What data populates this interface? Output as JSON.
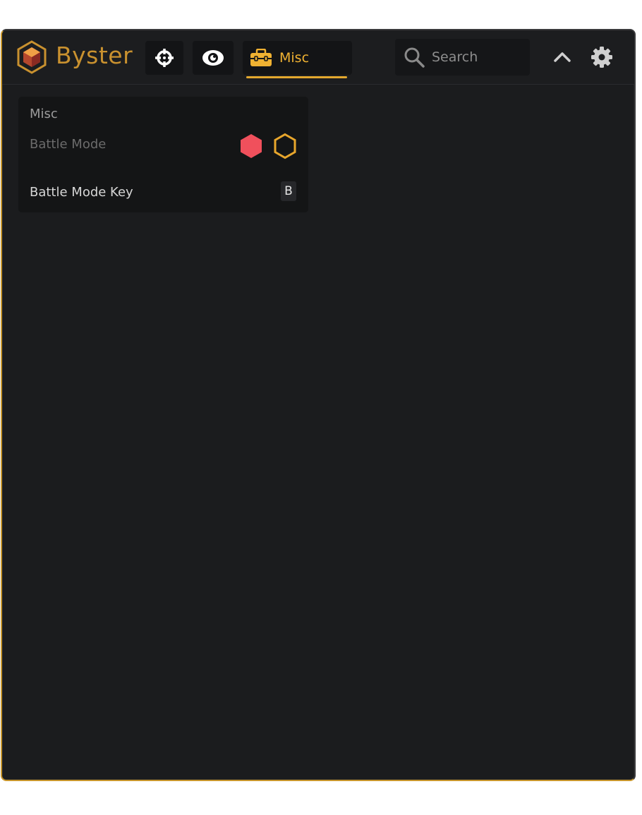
{
  "app": {
    "brand": "Byster",
    "accent_color": "#c9912f"
  },
  "toolbar": {
    "tabs": [
      {
        "icon": "crosshair-icon",
        "label": ""
      },
      {
        "icon": "eye-icon",
        "label": ""
      },
      {
        "icon": "toolbox-icon",
        "label": "Misc",
        "active": true
      }
    ],
    "search": {
      "placeholder": "Search",
      "value": ""
    },
    "collapse_icon": "chevron-up-icon",
    "settings_icon": "gear-icon"
  },
  "panel": {
    "title": "Misc",
    "rows": [
      {
        "label": "Battle Mode",
        "options": [
          {
            "icon": "hexagon-filled-icon",
            "color": "#f0505c"
          },
          {
            "icon": "hexagon-outline-icon",
            "color": "#e8a62c"
          }
        ]
      },
      {
        "label": "Battle Mode Key",
        "key": "B"
      }
    ]
  }
}
